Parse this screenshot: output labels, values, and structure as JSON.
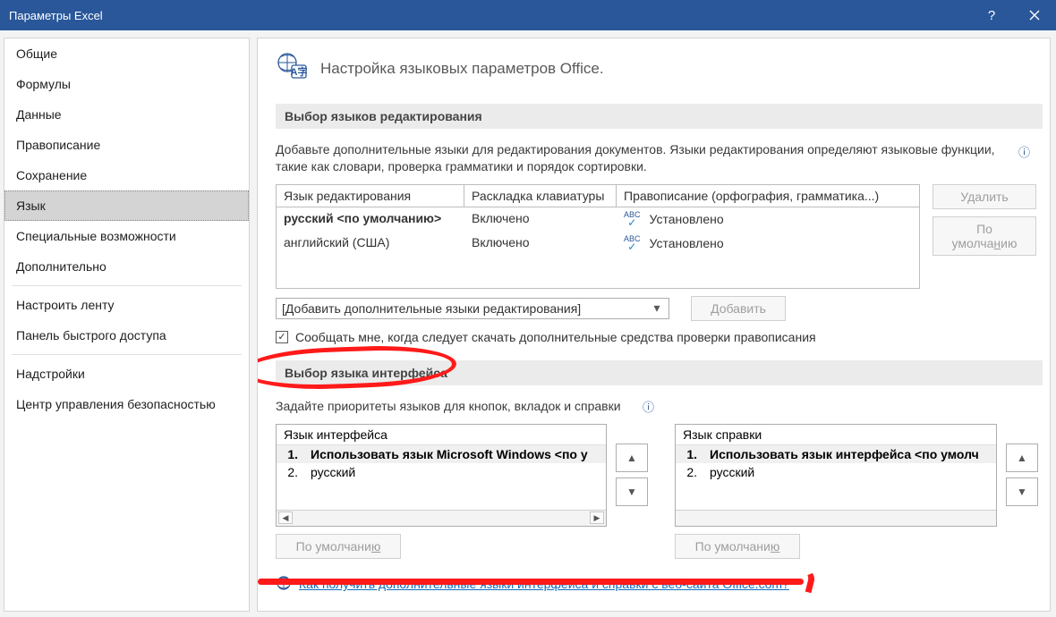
{
  "window": {
    "title": "Параметры Excel"
  },
  "sidebar": {
    "items": [
      {
        "label": "Общие"
      },
      {
        "label": "Формулы"
      },
      {
        "label": "Данные"
      },
      {
        "label": "Правописание"
      },
      {
        "label": "Сохранение"
      },
      {
        "label": "Язык"
      },
      {
        "label": "Специальные возможности"
      },
      {
        "label": "Дополнительно"
      },
      {
        "label": "Настроить ленту"
      },
      {
        "label": "Панель быстрого доступа"
      },
      {
        "label": "Надстройки"
      },
      {
        "label": "Центр управления безопасностью"
      }
    ],
    "selected": 5
  },
  "header": {
    "title": "Настройка языковых параметров Office."
  },
  "editing": {
    "section": "Выбор языков редактирования",
    "desc": "Добавьте дополнительные языки для редактирования документов. Языки редактирования определяют языковые функции, такие как словари, проверка грамматики и порядок сортировки.",
    "cols": {
      "a": "Язык редактирования",
      "b": "Раскладка клавиатуры",
      "c": "Правописание (орфография, грамматика...)"
    },
    "rows": [
      {
        "lang": "русский <по умолчанию>",
        "kb": "Включено",
        "spell": "Установлено",
        "bold": true
      },
      {
        "lang": "английский (США)",
        "kb": "Включено",
        "spell": "Установлено",
        "bold": false
      }
    ],
    "delete_btn": "Удалить",
    "default_btn_html": "По умолча<u>н</u>ию",
    "add_dropdown": "[Добавить дополнительные языки редактирования]",
    "add_btn_html": "<u>Д</u>обавить",
    "notify_chk": "Сообщать мне, когда следует скачать дополнительные средства проверки правописания"
  },
  "ui_lang": {
    "section": "Выбор языка интерфейса",
    "desc": "Задайте приоритеты языков для кнопок, вкладок и справки",
    "interface": {
      "label": "Язык интерфейса",
      "items": [
        {
          "n": "1.",
          "t": "Использовать язык Microsoft Windows <по у"
        },
        {
          "n": "2.",
          "t": "русский"
        }
      ]
    },
    "help": {
      "label": "Язык справки",
      "items": [
        {
          "n": "1.",
          "t": "Использовать язык интерфейса <по умолч"
        },
        {
          "n": "2.",
          "t": "русский"
        }
      ]
    },
    "default_btn_html": "По умолчани<u>ю</u>",
    "link": "Как получить дополнительные языки интерфейса и справки с веб-сайта Office.com?"
  }
}
